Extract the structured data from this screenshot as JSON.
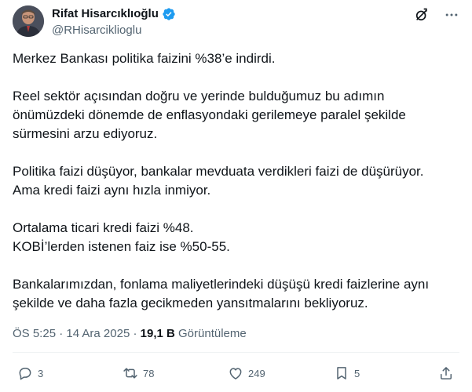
{
  "author": {
    "name": "Rifat Hisarcıklıoğlu",
    "handle": "@RHisarciklioglu",
    "verified_color": "#1d9bf0"
  },
  "icons": {
    "grok": "grok-icon",
    "more": "more-icon"
  },
  "tweet": {
    "paragraphs": [
      [
        "Merkez Bankası politika faizini %38’e indirdi."
      ],
      [
        "Reel sektör açısından doğru ve yerinde bulduğumuz bu adımın",
        "önümüzdeki dönemde de enflasyondaki gerilemeye paralel şekilde",
        "sürmesini arzu ediyoruz."
      ],
      [
        "Politika faizi düşüyor, bankalar mevduata verdikleri faizi de düşürüyor.",
        "Ama kredi faizi aynı hızla inmiyor."
      ],
      [
        "Ortalama ticari kredi faizi %48.",
        "KOBİ’lerden istenen faiz ise %50-55."
      ],
      [
        "Bankalarımızdan, fonlama maliyetlerindeki düşüşü kredi faizlerine aynı",
        "şekilde ve daha fazla gecikmeden yansıtmalarını bekliyoruz."
      ]
    ]
  },
  "meta": {
    "time": "ÖS 5:25",
    "separator": "·",
    "date": "14 Ara 2025",
    "views_count": "19,1 B",
    "views_label": "Görüntüleme"
  },
  "actions": {
    "reply": "3",
    "retweet": "78",
    "like": "249",
    "bookmark": "5"
  },
  "colors": {
    "text": "#0f1419",
    "secondary": "#536471",
    "accent": "#1d9bf0"
  }
}
